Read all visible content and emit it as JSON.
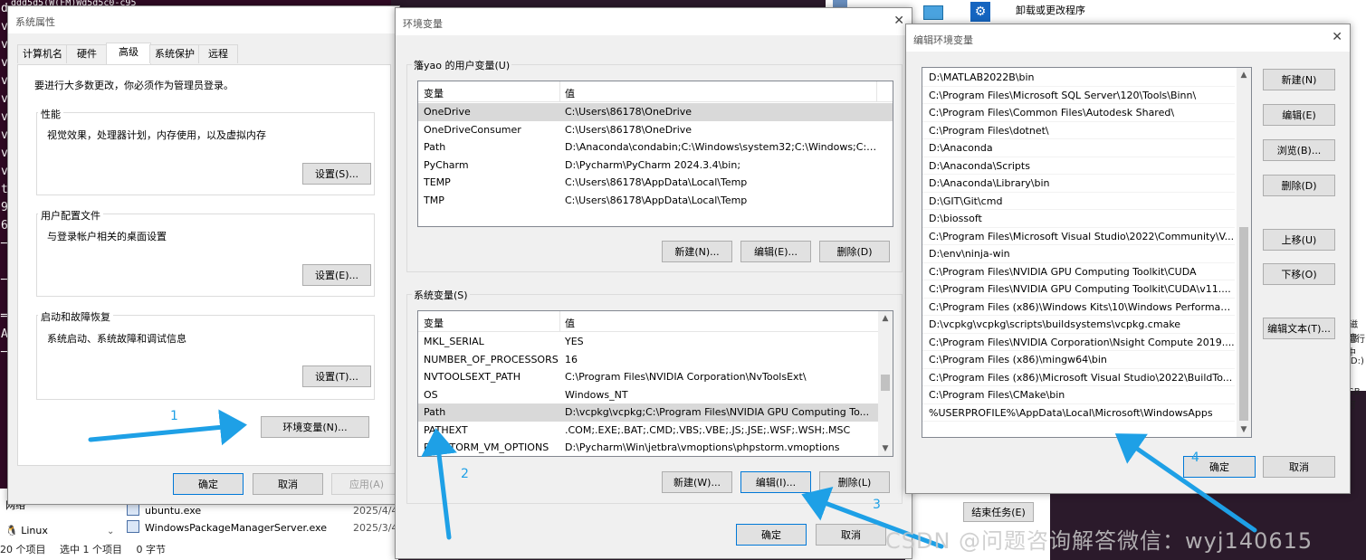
{
  "terminal": {
    "top_text": "ddd5d5(W(FM)Wd5d5c0-c95",
    "lines": [
      "d",
      "v",
      "v",
      "v",
      "v",
      "v",
      "v",
      "v",
      "v",
      "v",
      "t",
      "9",
      "6",
      "─",
      "",
      "─",
      "",
      "═",
      "A",
      "─"
    ]
  },
  "background": {
    "uninstall_label": "卸载或更改程序",
    "right_texts": [
      "磁盘",
      "运行中",
      "(D:)",
      "GB 可"
    ],
    "end_task_label": "结束任务(E)"
  },
  "explorer": {
    "nav_items": [
      "网络",
      "Linux"
    ],
    "files": [
      {
        "name": "ubuntu.exe",
        "date": "2025/4/4"
      },
      {
        "name": "WindowsPackageManagerServer.exe",
        "date": "2025/3/4"
      }
    ],
    "status": [
      "20 个项目",
      "选中 1 个项目",
      "0 字节"
    ]
  },
  "sysprops": {
    "title": "系统属性",
    "tabs": [
      "计算机名",
      "硬件",
      "高级",
      "系统保护",
      "远程"
    ],
    "active_tab": "高级",
    "admin_note": "要进行大多数更改，你必须作为管理员登录。",
    "perf_label": "性能",
    "perf_desc": "视觉效果，处理器计划，内存使用，以及虚拟内存",
    "perf_btn": "设置(S)...",
    "profile_label": "用户配置文件",
    "profile_desc": "与登录帐户相关的桌面设置",
    "profile_btn": "设置(E)...",
    "startup_label": "启动和故障恢复",
    "startup_desc": "系统启动、系统故障和调试信息",
    "startup_btn": "设置(T)...",
    "env_btn": "环境变量(N)...",
    "ok": "确定",
    "cancel": "取消",
    "apply": "应用(A)"
  },
  "envvars": {
    "title": "环境变量",
    "user_group": "籓yao 的用户变量(U)",
    "col_var": "变量",
    "col_val": "值",
    "user_rows": [
      {
        "name": "OneDrive",
        "value": "C:\\Users\\86178\\OneDrive"
      },
      {
        "name": "OneDriveConsumer",
        "value": "C:\\Users\\86178\\OneDrive"
      },
      {
        "name": "Path",
        "value": "D:\\Anaconda\\condabin;C:\\Windows\\system32;C:\\Windows;C:\\..."
      },
      {
        "name": "PyCharm",
        "value": "D:\\Pycharm\\PyCharm 2024.3.4\\bin;"
      },
      {
        "name": "TEMP",
        "value": "C:\\Users\\86178\\AppData\\Local\\Temp"
      },
      {
        "name": "TMP",
        "value": "C:\\Users\\86178\\AppData\\Local\\Temp"
      }
    ],
    "user_new": "新建(N)...",
    "user_edit": "编辑(E)...",
    "user_delete": "删除(D)",
    "sys_group": "系统变量(S)",
    "sys_rows": [
      {
        "name": "MKL_SERIAL",
        "value": "YES"
      },
      {
        "name": "NUMBER_OF_PROCESSORS",
        "value": "16"
      },
      {
        "name": "NVTOOLSEXT_PATH",
        "value": "C:\\Program Files\\NVIDIA Corporation\\NvToolsExt\\"
      },
      {
        "name": "OS",
        "value": "Windows_NT"
      },
      {
        "name": "Path",
        "value": "D:\\vcpkg\\vcpkg;C:\\Program Files\\NVIDIA GPU Computing To..."
      },
      {
        "name": "PATHEXT",
        "value": ".COM;.EXE;.BAT;.CMD;.VBS;.VBE;.JS;.JSE;.WSF;.WSH;.MSC"
      },
      {
        "name": "PHPSTORM_VM_OPTIONS",
        "value": "D:\\Pycharm\\Win\\jetbra\\vmoptions\\phpstorm.vmoptions"
      }
    ],
    "sys_new": "新建(W)...",
    "sys_edit": "编辑(I)...",
    "sys_delete": "删除(L)",
    "ok": "确定",
    "cancel": "取消"
  },
  "editenv": {
    "title": "编辑环境变量",
    "entries": [
      "D:\\MATLAB2022B\\bin",
      "C:\\Program Files\\Microsoft SQL Server\\120\\Tools\\Binn\\",
      "C:\\Program Files\\Common Files\\Autodesk Shared\\",
      "C:\\Program Files\\dotnet\\",
      "D:\\Anaconda",
      "D:\\Anaconda\\Scripts",
      "D:\\Anaconda\\Library\\bin",
      "D:\\GIT\\Git\\cmd",
      "D:\\biossoft",
      "C:\\Program Files\\Microsoft Visual Studio\\2022\\Community\\V...",
      "D:\\env\\ninja-win",
      "C:\\Program Files\\NVIDIA GPU Computing Toolkit\\CUDA",
      "C:\\Program Files\\NVIDIA GPU Computing Toolkit\\CUDA\\v11....",
      "C:\\Program Files (x86)\\Windows Kits\\10\\Windows Performan...",
      "D:\\vcpkg\\vcpkg\\scripts\\buildsystems\\vcpkg.cmake",
      "C:\\Program Files\\NVIDIA Corporation\\Nsight Compute 2019....",
      "C:\\Program Files (x86)\\mingw64\\bin",
      "C:\\Program Files (x86)\\Microsoft Visual Studio\\2022\\BuildTo...",
      "C:\\Program Files\\CMake\\bin",
      "%USERPROFILE%\\AppData\\Local\\Microsoft\\WindowsApps"
    ],
    "new": "新建(N)",
    "edit": "编辑(E)",
    "browse": "浏览(B)...",
    "delete": "删除(D)",
    "move_up": "上移(U)",
    "move_down": "下移(O)",
    "edit_text": "编辑文本(T)...",
    "ok": "确定",
    "cancel": "取消"
  },
  "annotations": {
    "step1": "1",
    "step2": "2",
    "step3": "3",
    "step4": "4",
    "arrow_color": "#1ea0e6"
  },
  "watermark": "CSDN @问题咨询解答微信：wyj140615"
}
